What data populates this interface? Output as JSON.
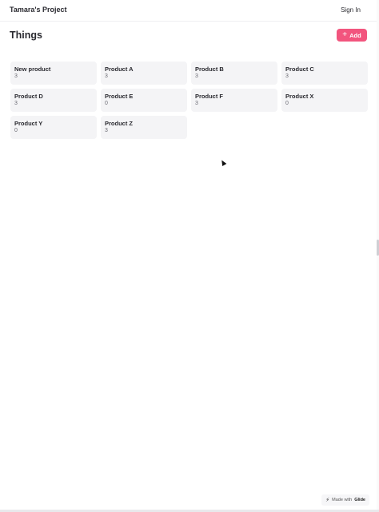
{
  "header": {
    "project_title": "Tamara's Project",
    "sign_in_label": "Sign In"
  },
  "main": {
    "heading": "Things",
    "add_label": "Add",
    "items": [
      {
        "title": "New product",
        "value": "3"
      },
      {
        "title": "Product A",
        "value": "3"
      },
      {
        "title": "Product B",
        "value": "3"
      },
      {
        "title": "Product C",
        "value": "3"
      },
      {
        "title": "Product D",
        "value": "3"
      },
      {
        "title": "Product E",
        "value": "0"
      },
      {
        "title": "Product F",
        "value": "3"
      },
      {
        "title": "Product X",
        "value": "0"
      },
      {
        "title": "Product Y",
        "value": "0"
      },
      {
        "title": "Product Z",
        "value": "3"
      }
    ]
  },
  "footer": {
    "made_with_prefix": "Made with",
    "made_with_brand": "Glide"
  },
  "colors": {
    "accent": "#f2557e",
    "card_bg": "#f4f4f6"
  },
  "icons": {
    "add": "plus-icon",
    "brand": "glide-icon"
  }
}
